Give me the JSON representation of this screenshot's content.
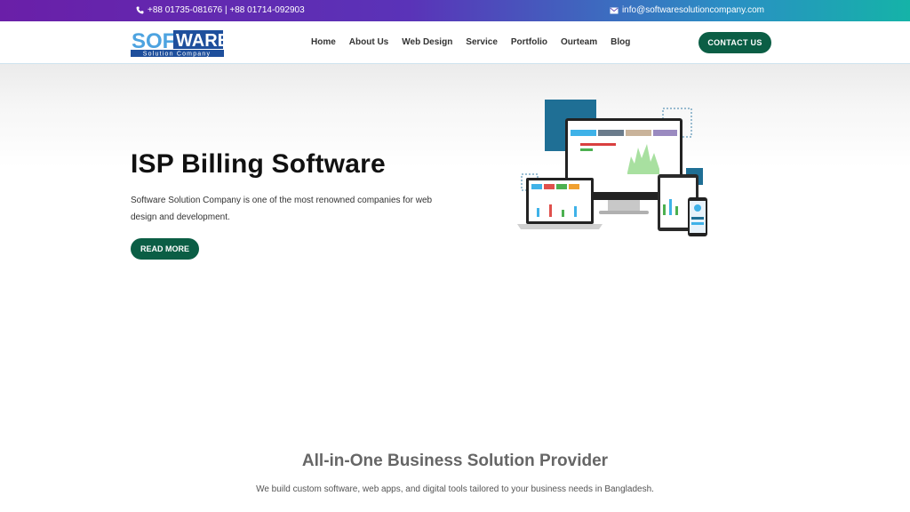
{
  "topbar": {
    "phones": "+88 01735-081676 | +88 01714-092903",
    "email": "info@softwaresolutioncompany.com"
  },
  "header": {
    "logo": {
      "word_prefix": "SOF",
      "word_suffix": "WARE",
      "tagline": "Solution Company"
    },
    "nav": [
      "Home",
      "About Us",
      "Web Design",
      "Service",
      "Portfolio",
      "Ourteam",
      "Blog"
    ],
    "contact_label": "CONTACT US"
  },
  "hero": {
    "title": "ISP Billing Software",
    "description": "Software Solution Company is one of the most renowned companies for web design and development.",
    "button_label": "READ MORE"
  },
  "section": {
    "title": "All-in-One Business Solution Provider",
    "subtitle": "We build custom software, web apps, and digital tools tailored to your business needs in Bangladesh."
  },
  "colors": {
    "brand_green": "#0b5e45",
    "topbar_start": "#6a1fa8",
    "topbar_end": "#15b3a8",
    "logo_blue": "#1e4f9c"
  }
}
